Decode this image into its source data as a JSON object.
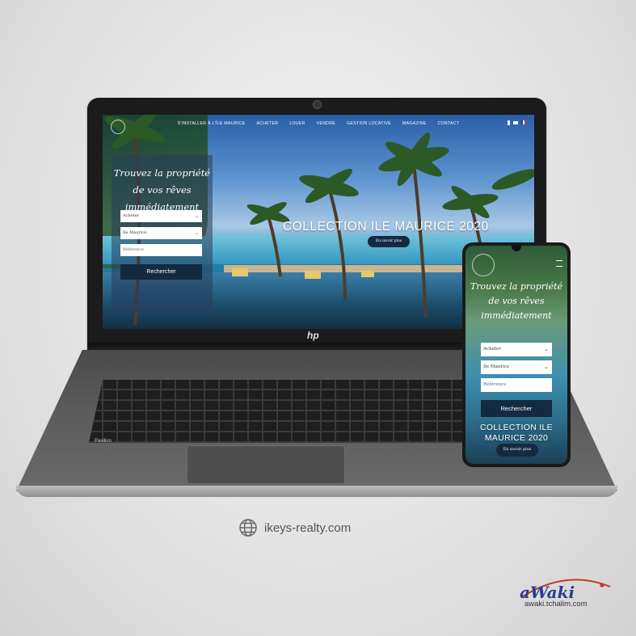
{
  "laptop": {
    "brand": "hp",
    "model_label": "Pavilion",
    "website": {
      "nav": {
        "items": [
          "S'INSTALLER À L'ÎLE MAURICE",
          "ACHETER",
          "LOUER",
          "VENDRE",
          "GESTION LOCATIVE",
          "MAGAZINE",
          "CONTACT"
        ],
        "icons": [
          "phone-icon",
          "mail-icon",
          "french-flag-icon"
        ]
      },
      "search": {
        "title": "Trouvez la propriété de vos rêves immédiatement",
        "transaction_value": "Acheter",
        "location_value": "Ile Maurice",
        "reference_placeholder": "Référence",
        "submit_label": "Rechercher"
      },
      "hero": {
        "title": "COLLECTION ILE MAURICE 2020",
        "button_label": "En savoir plus"
      }
    }
  },
  "phone": {
    "website": {
      "search": {
        "title": "Trouvez la propriété de vos rêves immédiatement",
        "transaction_value": "Acheter",
        "location_value": "Ile Maurice",
        "reference_placeholder": "Référence",
        "submit_label": "Rechercher"
      },
      "hero": {
        "title": "COLLECTION ILE MAURICE 2020",
        "button_label": "En savoir plus"
      }
    }
  },
  "footer": {
    "url": "ikeys-realty.com",
    "credit_brand": "aWaki",
    "credit_url": "awaki.tchalim.com"
  },
  "colors": {
    "button_dark": "#132a40",
    "background": "#e2e2e2",
    "brand_red": "#c0392b",
    "brand_blue": "#2a3d8f"
  }
}
